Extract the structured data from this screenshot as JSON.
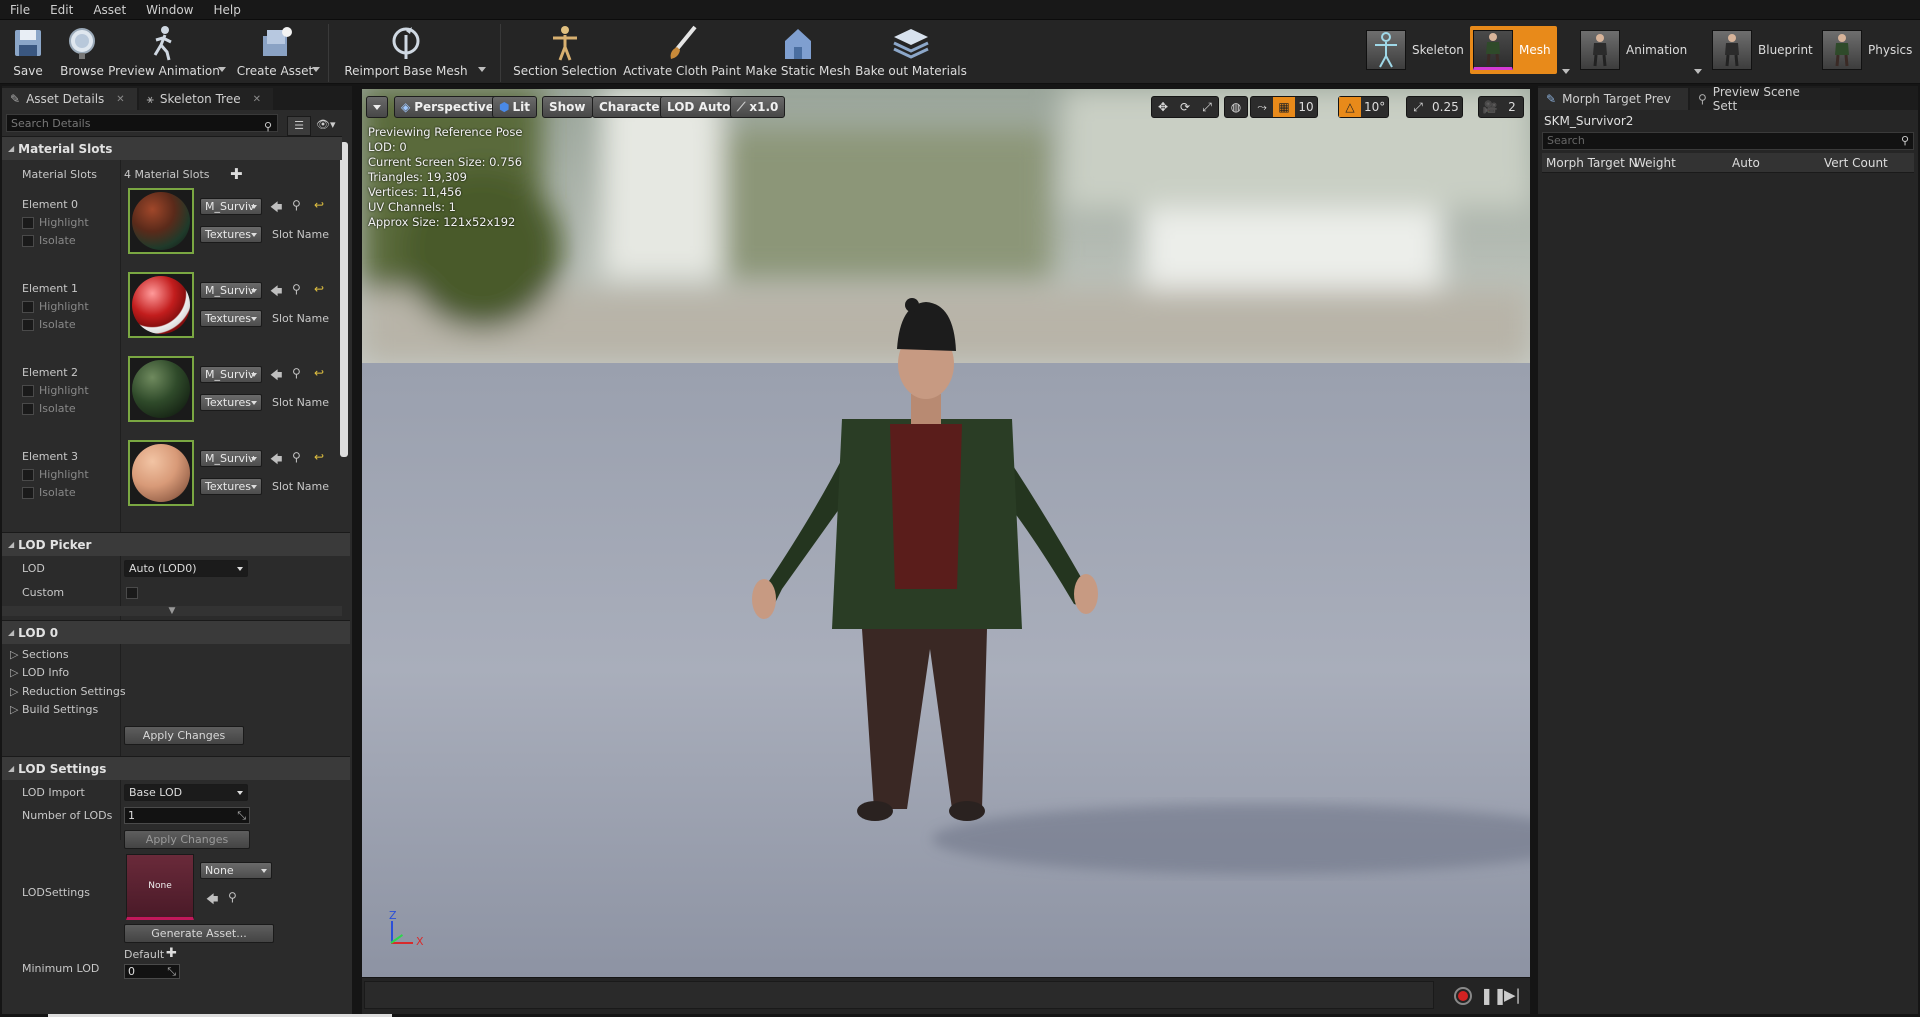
{
  "menu": [
    "File",
    "Edit",
    "Asset",
    "Window",
    "Help"
  ],
  "toolbar": {
    "save": "Save",
    "browse": "Browse",
    "preview_animation": "Preview Animation",
    "create_asset": "Create Asset",
    "reimport": "Reimport Base Mesh",
    "section_selection": "Section Selection",
    "activate_cloth": "Activate Cloth Paint",
    "make_static": "Make Static Mesh",
    "bake_materials": "Bake out Materials"
  },
  "modes": {
    "skeleton": "Skeleton",
    "mesh": "Mesh",
    "animation": "Animation",
    "blueprint": "Blueprint",
    "physics": "Physics"
  },
  "left": {
    "tab_asset_details": "Asset Details",
    "tab_skeleton_tree": "Skeleton Tree",
    "search_placeholder": "Search Details",
    "material_slots_header": "Material Slots",
    "material_slots_label": "Material Slots",
    "material_slots_count": "4 Material Slots",
    "elements": [
      {
        "name": "Element 0",
        "material": "M_Surviv",
        "textures": "Textures",
        "slot": "Slot Name",
        "highlight": "Highlight",
        "isolate": "Isolate"
      },
      {
        "name": "Element 1",
        "material": "M_Surviv",
        "textures": "Textures",
        "slot": "Slot Name",
        "highlight": "Highlight",
        "isolate": "Isolate"
      },
      {
        "name": "Element 2",
        "material": "M_Surviv",
        "textures": "Textures",
        "slot": "Slot Name",
        "highlight": "Highlight",
        "isolate": "Isolate"
      },
      {
        "name": "Element 3",
        "material": "M_Surviv",
        "textures": "Textures",
        "slot": "Slot Name",
        "highlight": "Highlight",
        "isolate": "Isolate"
      }
    ],
    "lod_picker_header": "LOD Picker",
    "lod_label": "LOD",
    "lod_value": "Auto (LOD0)",
    "custom_label": "Custom",
    "lod0_header": "LOD 0",
    "sections": "Sections",
    "lod_info": "LOD Info",
    "reduction_settings": "Reduction Settings",
    "build_settings": "Build Settings",
    "apply_changes": "Apply Changes",
    "lod_settings_header": "LOD Settings",
    "lod_import_label": "LOD Import",
    "lod_import_value": "Base LOD",
    "num_lods_label": "Number of LODs",
    "num_lods_value": "1",
    "apply_changes_2": "Apply Changes",
    "lodsettings_label": "LODSettings",
    "lodsettings_thumb": "None",
    "lodsettings_value": "None",
    "generate_asset": "Generate Asset...",
    "min_lod_label": "Minimum LOD",
    "min_lod_default": "Default",
    "min_lod_value": "0"
  },
  "viewport": {
    "perspective": "Perspective",
    "lit": "Lit",
    "show": "Show",
    "character": "Character",
    "lod_auto": "LOD Auto",
    "speed": "x1.0",
    "grid": "10",
    "rot": "10°",
    "scale": "0.25",
    "cam": "2",
    "stats": [
      "Previewing Reference Pose",
      "LOD: 0",
      "Current Screen Size: 0.756",
      "Triangles: 19,309",
      "Vertices: 11,456",
      "UV Channels: 1",
      "Approx Size: 121x52x192"
    ],
    "axis_z": "Z",
    "axis_x": "X"
  },
  "right": {
    "tab_morph": "Morph Target Prev",
    "tab_scene": "Preview Scene Sett",
    "asset_name": "SKM_Survivor2",
    "search_placeholder": "Search",
    "columns": [
      "Morph Target N",
      "Weight",
      "Auto",
      "Vert Count"
    ]
  },
  "colors": {
    "accent_orange": "#e88a1a",
    "material_border": "#7aa742"
  }
}
